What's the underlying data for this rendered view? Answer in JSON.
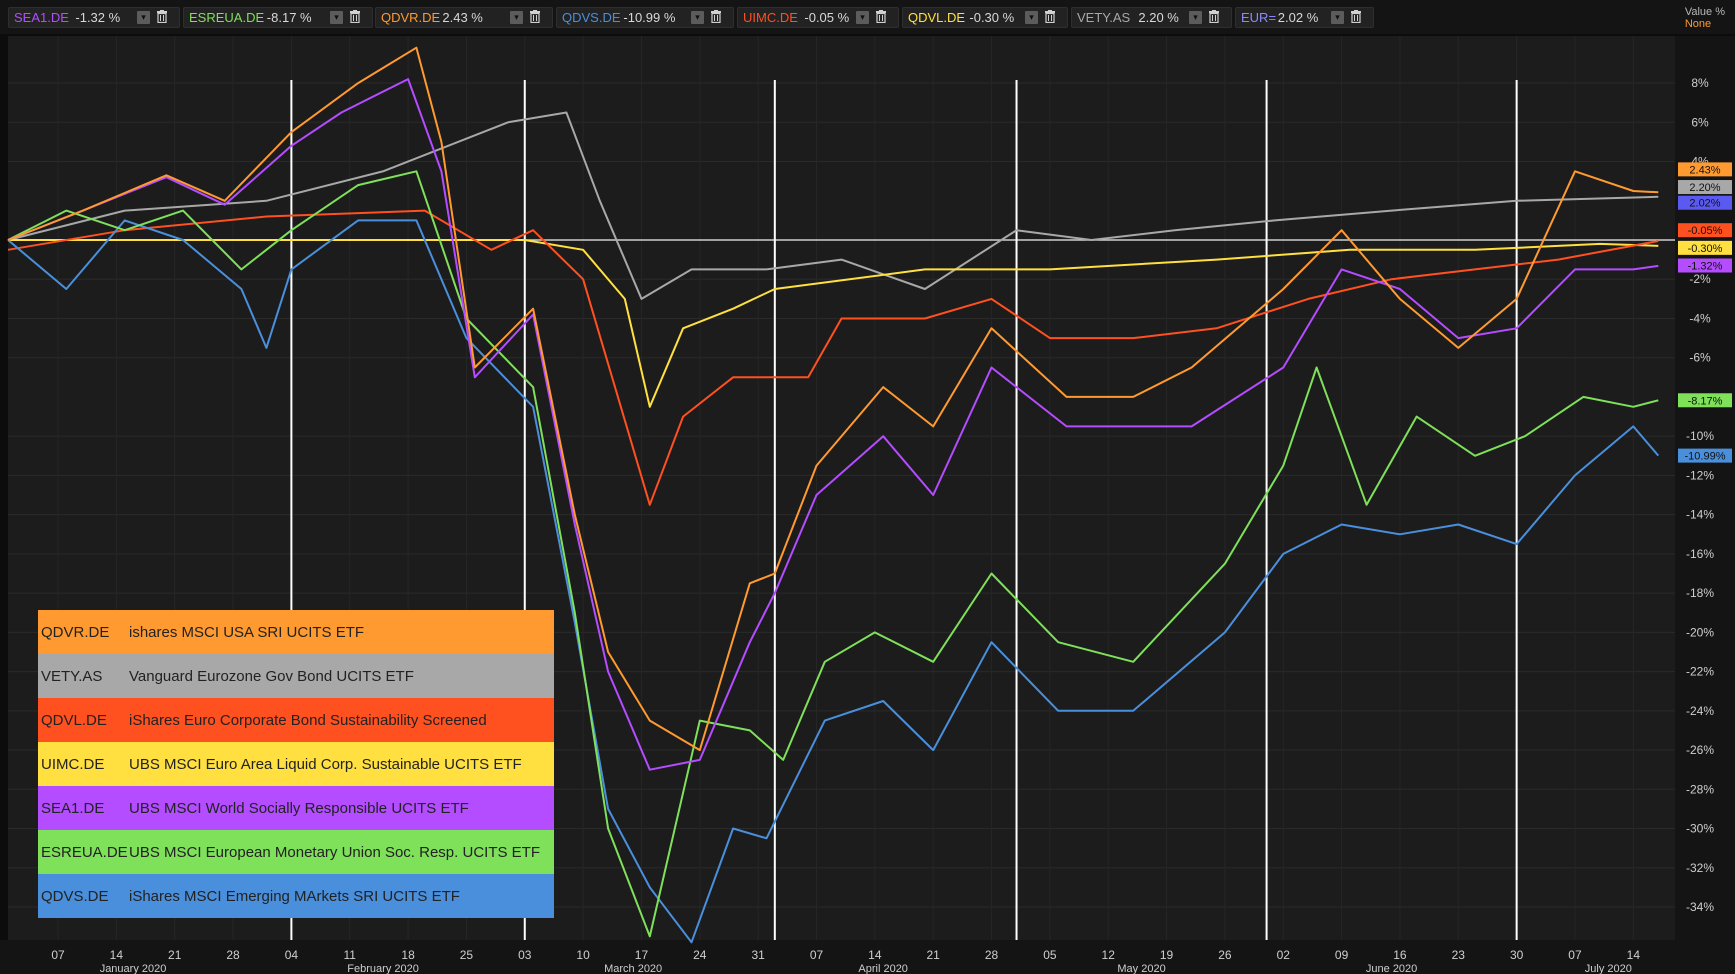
{
  "toolbar": {
    "chips": [
      {
        "symbol": "SEA1.DE",
        "change": "-1.32 %",
        "color": "#b44cff"
      },
      {
        "symbol": "ESREUA.DE",
        "change": "-8.17 %",
        "color": "#7fe05a"
      },
      {
        "symbol": "QDVR.DE",
        "change": "2.43 %",
        "color": "#ff9a30"
      },
      {
        "symbol": "QDVS.DE",
        "change": "-10.99 %",
        "color": "#4a8fdc"
      },
      {
        "symbol": "UIMC.DE",
        "change": "-0.05 %",
        "color": "#ff5020"
      },
      {
        "symbol": "QDVL.DE",
        "change": "-0.30 %",
        "color": "#ffe040"
      },
      {
        "symbol": "VETY.AS",
        "change": "2.20 %",
        "color": "#a8a8a8"
      },
      {
        "symbol": "EUR=",
        "change": "2.02 %",
        "color": "#8a8aff"
      }
    ],
    "dropdown_icon": "chevron-down-icon",
    "delete_icon": "trash-icon"
  },
  "value_header": {
    "line1": "Value %",
    "line2": "None"
  },
  "chart_data": {
    "type": "line",
    "ylabel": "Value %",
    "ylim": [
      -36,
      10
    ],
    "y_ticks": [
      "8%",
      "6%",
      "4%",
      "-2%",
      "-4%",
      "-6%",
      "-10%",
      "-12%",
      "-14%",
      "-16%",
      "-18%",
      "-20%",
      "-22%",
      "-24%",
      "-26%",
      "-28%",
      "-30%",
      "-32%",
      "-34%"
    ],
    "y_tick_values": [
      8,
      6,
      4,
      -2,
      -4,
      -6,
      -10,
      -12,
      -14,
      -16,
      -18,
      -20,
      -22,
      -24,
      -26,
      -28,
      -30,
      -32,
      -34
    ],
    "x_day_ticks": [
      "07",
      "14",
      "21",
      "28",
      "04",
      "11",
      "18",
      "25",
      "03",
      "10",
      "17",
      "24",
      "31",
      "07",
      "14",
      "21",
      "28",
      "05",
      "12",
      "19",
      "26",
      "02",
      "09",
      "16",
      "23",
      "30",
      "07",
      "14"
    ],
    "x_day_tick_dates": [
      "2020-01-07",
      "2020-01-14",
      "2020-01-21",
      "2020-01-28",
      "2020-02-04",
      "2020-02-11",
      "2020-02-18",
      "2020-02-25",
      "2020-03-03",
      "2020-03-10",
      "2020-03-17",
      "2020-03-24",
      "2020-03-31",
      "2020-04-07",
      "2020-04-14",
      "2020-04-21",
      "2020-04-28",
      "2020-05-05",
      "2020-05-12",
      "2020-05-19",
      "2020-05-26",
      "2020-06-02",
      "2020-06-09",
      "2020-06-16",
      "2020-06-23",
      "2020-06-30",
      "2020-07-07",
      "2020-07-14"
    ],
    "x_month_labels": [
      {
        "label": "January 2020",
        "date": "2020-01-16"
      },
      {
        "label": "February 2020",
        "date": "2020-02-15"
      },
      {
        "label": "March 2020",
        "date": "2020-03-16"
      },
      {
        "label": "April 2020",
        "date": "2020-04-15"
      },
      {
        "label": "May 2020",
        "date": "2020-05-16"
      },
      {
        "label": "June 2020",
        "date": "2020-06-15"
      },
      {
        "label": "July 2020",
        "date": "2020-07-11"
      }
    ],
    "x_range": [
      "2020-01-01",
      "2020-07-19"
    ],
    "zero_line": 0,
    "vertical_markers": [
      "2020-02-04",
      "2020-03-03",
      "2020-04-02",
      "2020-05-01",
      "2020-05-31",
      "2020-06-30"
    ],
    "end_labels": [
      {
        "text": "2.43%",
        "value": 3.6,
        "color": "#ff9a30"
      },
      {
        "text": "2.20%",
        "value": 2.7,
        "color": "#a8a8a8"
      },
      {
        "text": "2.02%",
        "value": 1.9,
        "color": "#5a5af0"
      },
      {
        "text": "-0.05%",
        "value": 0.5,
        "color": "#ff5020"
      },
      {
        "text": "-0.30%",
        "value": -0.4,
        "color": "#ffe040"
      },
      {
        "text": "-1.32%",
        "value": -1.3,
        "color": "#b44cff"
      },
      {
        "text": "-8.17%",
        "value": -8.17,
        "color": "#7fe05a"
      },
      {
        "text": "-10.99%",
        "value": -10.99,
        "color": "#4a8fdc"
      }
    ],
    "series": [
      {
        "name": "SEA1.DE",
        "color": "#b44cff",
        "x": [
          "2020-01-01",
          "2020-01-10",
          "2020-01-20",
          "2020-01-27",
          "2020-02-04",
          "2020-02-10",
          "2020-02-18",
          "2020-02-22",
          "2020-02-26",
          "2020-03-04",
          "2020-03-09",
          "2020-03-13",
          "2020-03-18",
          "2020-03-24",
          "2020-03-30",
          "2020-04-02",
          "2020-04-07",
          "2020-04-15",
          "2020-04-21",
          "2020-04-28",
          "2020-05-07",
          "2020-05-15",
          "2020-05-22",
          "2020-06-02",
          "2020-06-09",
          "2020-06-16",
          "2020-06-23",
          "2020-06-30",
          "2020-07-07",
          "2020-07-14",
          "2020-07-17"
        ],
        "y": [
          0,
          1.5,
          3.2,
          1.8,
          4.8,
          6.5,
          8.2,
          3.5,
          -7,
          -3.8,
          -14.5,
          -22,
          -27,
          -26.5,
          -20.5,
          -18,
          -13,
          -10,
          -13,
          -6.5,
          -9.5,
          -9.5,
          -9.5,
          -6.5,
          -1.5,
          -2.5,
          -5,
          -4.5,
          -1.5,
          -1.5,
          -1.32
        ]
      },
      {
        "name": "ESREUA.DE",
        "color": "#7fe05a",
        "x": [
          "2020-01-01",
          "2020-01-08",
          "2020-01-15",
          "2020-01-22",
          "2020-01-29",
          "2020-02-04",
          "2020-02-12",
          "2020-02-19",
          "2020-02-25",
          "2020-03-04",
          "2020-03-09",
          "2020-03-13",
          "2020-03-18",
          "2020-03-24",
          "2020-03-30",
          "2020-04-03",
          "2020-04-08",
          "2020-04-14",
          "2020-04-21",
          "2020-04-28",
          "2020-05-06",
          "2020-05-15",
          "2020-05-26",
          "2020-06-02",
          "2020-06-06",
          "2020-06-12",
          "2020-06-18",
          "2020-06-25",
          "2020-07-01",
          "2020-07-08",
          "2020-07-14",
          "2020-07-17"
        ],
        "y": [
          0,
          1.5,
          0.5,
          1.5,
          -1.5,
          0.5,
          2.8,
          3.5,
          -4,
          -7.5,
          -19,
          -30,
          -35.5,
          -24.5,
          -25,
          -26.5,
          -21.5,
          -20,
          -21.5,
          -17,
          -20.5,
          -21.5,
          -16.5,
          -11.5,
          -6.5,
          -13.5,
          -9,
          -11,
          -10,
          -8,
          -8.5,
          -8.17
        ]
      },
      {
        "name": "QDVR.DE",
        "color": "#ff9a30",
        "x": [
          "2020-01-01",
          "2020-01-10",
          "2020-01-20",
          "2020-01-27",
          "2020-02-04",
          "2020-02-12",
          "2020-02-19",
          "2020-02-22",
          "2020-02-26",
          "2020-03-04",
          "2020-03-09",
          "2020-03-13",
          "2020-03-18",
          "2020-03-24",
          "2020-03-30",
          "2020-04-02",
          "2020-04-07",
          "2020-04-15",
          "2020-04-21",
          "2020-04-28",
          "2020-05-07",
          "2020-05-15",
          "2020-05-22",
          "2020-06-02",
          "2020-06-09",
          "2020-06-16",
          "2020-06-23",
          "2020-06-30",
          "2020-07-07",
          "2020-07-14",
          "2020-07-17"
        ],
        "y": [
          0,
          1.5,
          3.3,
          2,
          5.5,
          8,
          9.8,
          5,
          -6.5,
          -3.5,
          -14,
          -21,
          -24.5,
          -26,
          -17.5,
          -17,
          -11.5,
          -7.5,
          -9.5,
          -4.5,
          -8,
          -8,
          -6.5,
          -2.5,
          0.5,
          -3,
          -5.5,
          -3,
          3.5,
          2.5,
          2.43
        ]
      },
      {
        "name": "QDVS.DE",
        "color": "#4a8fdc",
        "x": [
          "2020-01-01",
          "2020-01-08",
          "2020-01-15",
          "2020-01-22",
          "2020-01-29",
          "2020-02-01",
          "2020-02-04",
          "2020-02-12",
          "2020-02-19",
          "2020-02-25",
          "2020-03-04",
          "2020-03-09",
          "2020-03-13",
          "2020-03-18",
          "2020-03-23",
          "2020-03-28",
          "2020-04-01",
          "2020-04-08",
          "2020-04-15",
          "2020-04-21",
          "2020-04-28",
          "2020-05-06",
          "2020-05-15",
          "2020-05-26",
          "2020-06-02",
          "2020-06-09",
          "2020-06-16",
          "2020-06-23",
          "2020-06-30",
          "2020-07-07",
          "2020-07-14",
          "2020-07-17"
        ],
        "y": [
          0,
          -2.5,
          1,
          0,
          -2.5,
          -5.5,
          -1.5,
          1,
          1,
          -5,
          -8.5,
          -19.5,
          -29,
          -33,
          -35.8,
          -30,
          -30.5,
          -24.5,
          -23.5,
          -26,
          -20.5,
          -24,
          -24,
          -20,
          -16,
          -14.5,
          -15,
          -14.5,
          -15.5,
          -12,
          -9.5,
          -10.99
        ]
      },
      {
        "name": "UIMC.DE",
        "color": "#ff5020",
        "x": [
          "2020-01-01",
          "2020-01-15",
          "2020-02-01",
          "2020-02-20",
          "2020-02-28",
          "2020-03-04",
          "2020-03-10",
          "2020-03-18",
          "2020-03-22",
          "2020-03-28",
          "2020-04-06",
          "2020-04-10",
          "2020-04-20",
          "2020-04-28",
          "2020-05-05",
          "2020-05-15",
          "2020-05-25",
          "2020-06-05",
          "2020-06-15",
          "2020-06-25",
          "2020-07-05",
          "2020-07-17"
        ],
        "y": [
          -0.5,
          0.5,
          1.2,
          1.5,
          -0.5,
          0.5,
          -2,
          -13.5,
          -9,
          -7,
          -7,
          -4,
          -4,
          -3,
          -5,
          -5,
          -4.5,
          -3,
          -2,
          -1.5,
          -1,
          -0.05
        ]
      },
      {
        "name": "QDVL.DE",
        "color": "#ffe040",
        "x": [
          "2020-01-01",
          "2020-02-15",
          "2020-03-03",
          "2020-03-10",
          "2020-03-15",
          "2020-03-18",
          "2020-03-22",
          "2020-03-28",
          "2020-04-02",
          "2020-04-20",
          "2020-05-05",
          "2020-05-25",
          "2020-06-10",
          "2020-06-25",
          "2020-07-10",
          "2020-07-17"
        ],
        "y": [
          0,
          0,
          0,
          -0.5,
          -3,
          -8.5,
          -4.5,
          -3.5,
          -2.5,
          -1.5,
          -1.5,
          -1,
          -0.5,
          -0.5,
          -0.2,
          -0.3
        ]
      },
      {
        "name": "VETY.AS",
        "color": "#a8a8a8",
        "x": [
          "2020-01-01",
          "2020-01-15",
          "2020-02-01",
          "2020-02-15",
          "2020-03-01",
          "2020-03-08",
          "2020-03-12",
          "2020-03-17",
          "2020-03-23",
          "2020-04-01",
          "2020-04-10",
          "2020-04-20",
          "2020-05-01",
          "2020-05-10",
          "2020-05-20",
          "2020-06-01",
          "2020-06-15",
          "2020-06-30",
          "2020-07-17"
        ],
        "y": [
          0,
          1.5,
          2,
          3.5,
          6,
          6.5,
          2,
          -3,
          -1.5,
          -1.5,
          -1,
          -2.5,
          0.5,
          0,
          0.5,
          1,
          1.5,
          2,
          2.2
        ]
      }
    ]
  },
  "legend": {
    "rows": [
      {
        "ticker": "QDVR.DE",
        "name": "ishares MSCI USA SRI UCITS ETF",
        "bg": "#ff9a30"
      },
      {
        "ticker": "VETY.AS",
        "name": "Vanguard Eurozone Gov Bond UCITS  ETF",
        "bg": "#a8a8a8"
      },
      {
        "ticker": "QDVL.DE",
        "name": "iShares Euro Corporate Bond Sustainability Screened",
        "bg": "#ff5020"
      },
      {
        "ticker": "UIMC.DE",
        "name": "UBS MSCI Euro Area Liquid Corp. Sustainable UCITS ETF",
        "bg": "#ffe040"
      },
      {
        "ticker": "SEA1.DE",
        "name": "UBS MSCI World Socially Responsible UCITS ETF",
        "bg": "#b44cff"
      },
      {
        "ticker": "ESREUA.DE",
        "name": "UBS MSCI European Monetary Union Soc. Resp. UCITS ETF",
        "bg": "#7fe05a"
      },
      {
        "ticker": "QDVS.DE",
        "name": "iShares MSCI Emerging MArkets SRI UCITS ETF",
        "bg": "#4a8fdc"
      }
    ]
  }
}
